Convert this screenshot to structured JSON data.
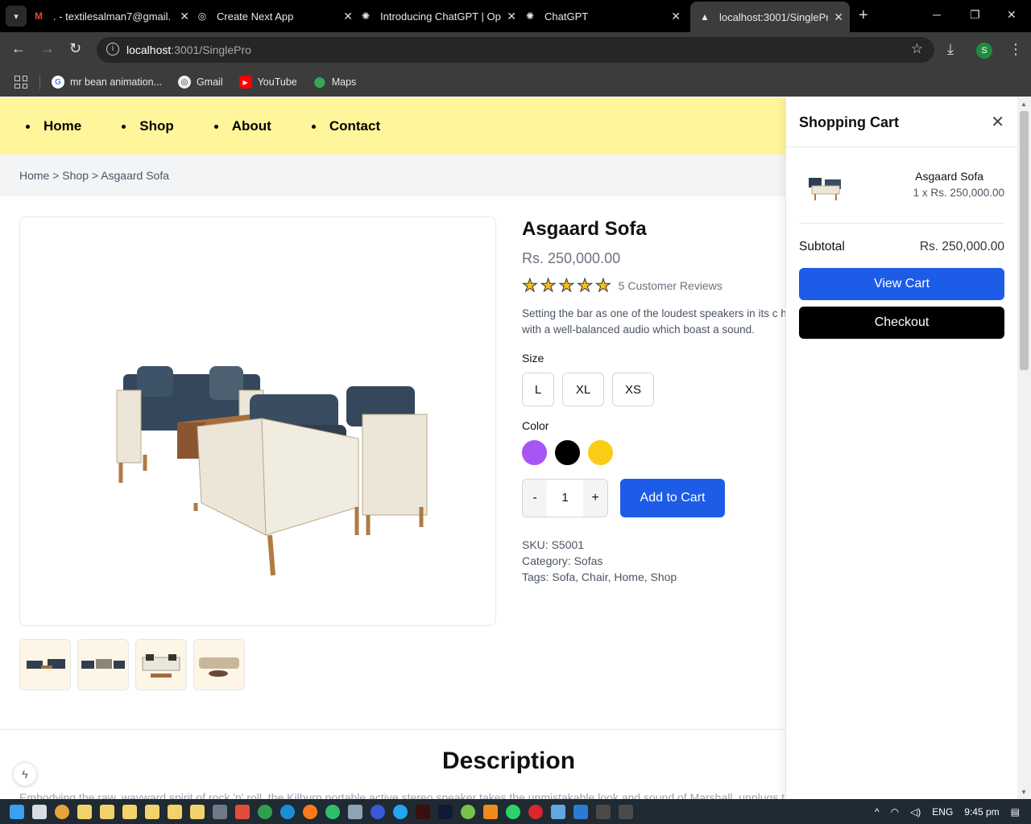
{
  "browser": {
    "tabs": [
      {
        "title": ". - textilesalman7@gmail.",
        "icon": "gmail-icon"
      },
      {
        "title": "Create Next App",
        "icon": "globe-icon"
      },
      {
        "title": "Introducing ChatGPT | Op",
        "icon": "openai-icon"
      },
      {
        "title": "ChatGPT",
        "icon": "openai-icon"
      },
      {
        "title": "localhost:3001/SinglePro",
        "icon": "nextjs-icon"
      }
    ],
    "url_host": "localhost",
    "url_rest": ":3001/SinglePro",
    "profile_initial": "S",
    "bookmarks": [
      {
        "label": "mr bean animation...",
        "icon": "google-icon"
      },
      {
        "label": "Gmail",
        "icon": "globe-icon"
      },
      {
        "label": "YouTube",
        "icon": "youtube-icon"
      },
      {
        "label": "Maps",
        "icon": "maps-icon"
      }
    ]
  },
  "site": {
    "nav": [
      "Home",
      "Shop",
      "About",
      "Contact"
    ],
    "breadcrumb": "Home > Shop > Asgaard Sofa"
  },
  "product": {
    "title": "Asgaard Sofa",
    "price": "Rs. 250,000.00",
    "rating": 5,
    "reviews": "5 Customer Reviews",
    "description": "Setting the bar as one of the loudest speakers in its c hearted hero with a well-balanced audio which boast a sound.",
    "size_label": "Size",
    "sizes": [
      "L",
      "XL",
      "XS"
    ],
    "color_label": "Color",
    "colors": [
      "#a855f7",
      "#000000",
      "#facc15"
    ],
    "quantity": "1",
    "minus": "-",
    "plus": "+",
    "add_to_cart": "Add to Cart",
    "sku": "SKU: S5001",
    "category": "Category: Sofas",
    "tags": "Tags: Sofa, Chair, Home, Shop"
  },
  "description_section": {
    "heading": "Description",
    "text": "Embodying the raw, wayward spirit of rock 'n' roll, the Kilburn portable active stereo speaker takes the unmistakable look and sound of Marshall, unplugs t"
  },
  "cart": {
    "title": "Shopping Cart",
    "item_name": "Asgaard Sofa",
    "item_qty": "1 x Rs. 250,000.00",
    "subtotal_label": "Subtotal",
    "subtotal_value": "Rs. 250,000.00",
    "view_cart": "View Cart",
    "checkout": "Checkout"
  },
  "taskbar": {
    "lang": "ENG",
    "time": "9:45 pm"
  }
}
